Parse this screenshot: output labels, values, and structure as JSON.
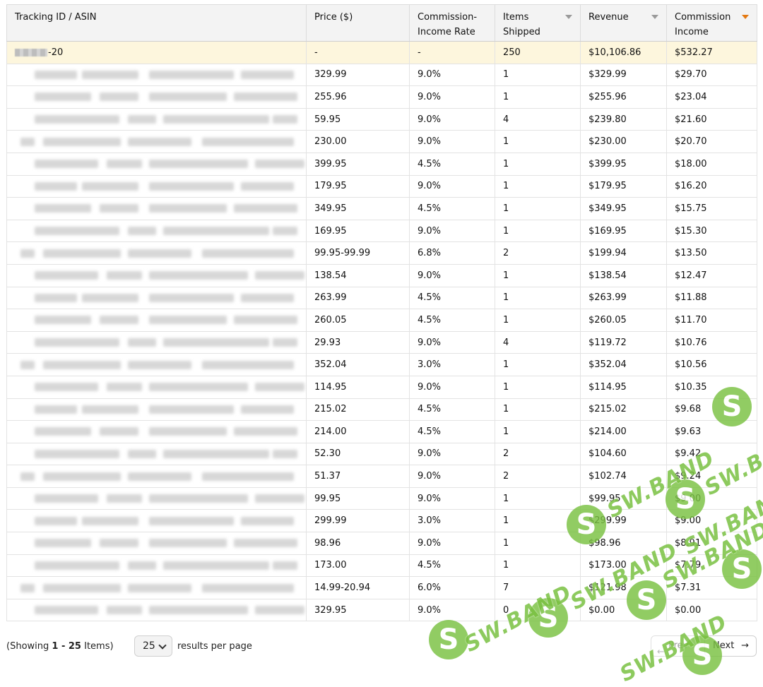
{
  "table": {
    "columns": [
      "Tracking ID / ASIN",
      "Price ($)",
      "Commission-\nIncome Rate",
      "Items\nShipped",
      "Revenue",
      "Commission\nIncome"
    ],
    "col_labels": {
      "c1": "Tracking ID / ASIN",
      "c2": "Price ($)",
      "c3a": "Commission-",
      "c3b": "Income Rate",
      "c4a": "Items",
      "c4b": "Shipped",
      "c5": "Revenue",
      "c6a": "Commission",
      "c6b": "Income"
    },
    "sorted_column": "Commission Income",
    "total_row": {
      "tracking_id_suffix": "-20",
      "price": "-",
      "rate": "-",
      "items": "250",
      "revenue": "$10,106.86",
      "commission": "$532.27"
    },
    "rows": [
      {
        "price": "329.99",
        "rate": "9.0%",
        "items": "1",
        "revenue": "$329.99",
        "commission": "$29.70"
      },
      {
        "price": "255.96",
        "rate": "9.0%",
        "items": "1",
        "revenue": "$255.96",
        "commission": "$23.04"
      },
      {
        "price": "59.95",
        "rate": "9.0%",
        "items": "4",
        "revenue": "$239.80",
        "commission": "$21.60"
      },
      {
        "price": "230.00",
        "rate": "9.0%",
        "items": "1",
        "revenue": "$230.00",
        "commission": "$20.70"
      },
      {
        "price": "399.95",
        "rate": "4.5%",
        "items": "1",
        "revenue": "$399.95",
        "commission": "$18.00"
      },
      {
        "price": "179.95",
        "rate": "9.0%",
        "items": "1",
        "revenue": "$179.95",
        "commission": "$16.20"
      },
      {
        "price": "349.95",
        "rate": "4.5%",
        "items": "1",
        "revenue": "$349.95",
        "commission": "$15.75"
      },
      {
        "price": "169.95",
        "rate": "9.0%",
        "items": "1",
        "revenue": "$169.95",
        "commission": "$15.30"
      },
      {
        "price": "99.95-99.99",
        "rate": "6.8%",
        "items": "2",
        "revenue": "$199.94",
        "commission": "$13.50"
      },
      {
        "price": "138.54",
        "rate": "9.0%",
        "items": "1",
        "revenue": "$138.54",
        "commission": "$12.47"
      },
      {
        "price": "263.99",
        "rate": "4.5%",
        "items": "1",
        "revenue": "$263.99",
        "commission": "$11.88"
      },
      {
        "price": "260.05",
        "rate": "4.5%",
        "items": "1",
        "revenue": "$260.05",
        "commission": "$11.70"
      },
      {
        "price": "29.93",
        "rate": "9.0%",
        "items": "4",
        "revenue": "$119.72",
        "commission": "$10.76"
      },
      {
        "price": "352.04",
        "rate": "3.0%",
        "items": "1",
        "revenue": "$352.04",
        "commission": "$10.56"
      },
      {
        "price": "114.95",
        "rate": "9.0%",
        "items": "1",
        "revenue": "$114.95",
        "commission": "$10.35"
      },
      {
        "price": "215.02",
        "rate": "4.5%",
        "items": "1",
        "revenue": "$215.02",
        "commission": "$9.68"
      },
      {
        "price": "214.00",
        "rate": "4.5%",
        "items": "1",
        "revenue": "$214.00",
        "commission": "$9.63"
      },
      {
        "price": "52.30",
        "rate": "9.0%",
        "items": "2",
        "revenue": "$104.60",
        "commission": "$9.42"
      },
      {
        "price": "51.37",
        "rate": "9.0%",
        "items": "2",
        "revenue": "$102.74",
        "commission": "$9.24"
      },
      {
        "price": "99.95",
        "rate": "9.0%",
        "items": "1",
        "revenue": "$99.95",
        "commission": "$9.00"
      },
      {
        "price": "299.99",
        "rate": "3.0%",
        "items": "1",
        "revenue": "$299.99",
        "commission": "$9.00"
      },
      {
        "price": "98.96",
        "rate": "9.0%",
        "items": "1",
        "revenue": "$98.96",
        "commission": "$8.91"
      },
      {
        "price": "173.00",
        "rate": "4.5%",
        "items": "1",
        "revenue": "$173.00",
        "commission": "$7.79"
      },
      {
        "price": "14.99-20.94",
        "rate": "6.0%",
        "items": "7",
        "revenue": "$121.98",
        "commission": "$7.31"
      },
      {
        "price": "329.95",
        "rate": "9.0%",
        "items": "0",
        "revenue": "$0.00",
        "commission": "$0.00"
      }
    ]
  },
  "footer": {
    "showing_prefix": "(Showing ",
    "showing_range": "1 - 25",
    "showing_suffix": " Items)",
    "per_page_value": "25",
    "per_page_label": "results per page",
    "prev_label": "Prev",
    "next_label": "Next",
    "next_arrow": "→",
    "prev_arrow": "←"
  },
  "watermark": {
    "brand": "SW.BAND",
    "logo_letter": "S"
  },
  "colors": {
    "header_bg": "#f3f3f3",
    "total_row_bg": "#fdf6dd",
    "sort_active": "#e47911",
    "watermark_green": "#7ac142"
  }
}
